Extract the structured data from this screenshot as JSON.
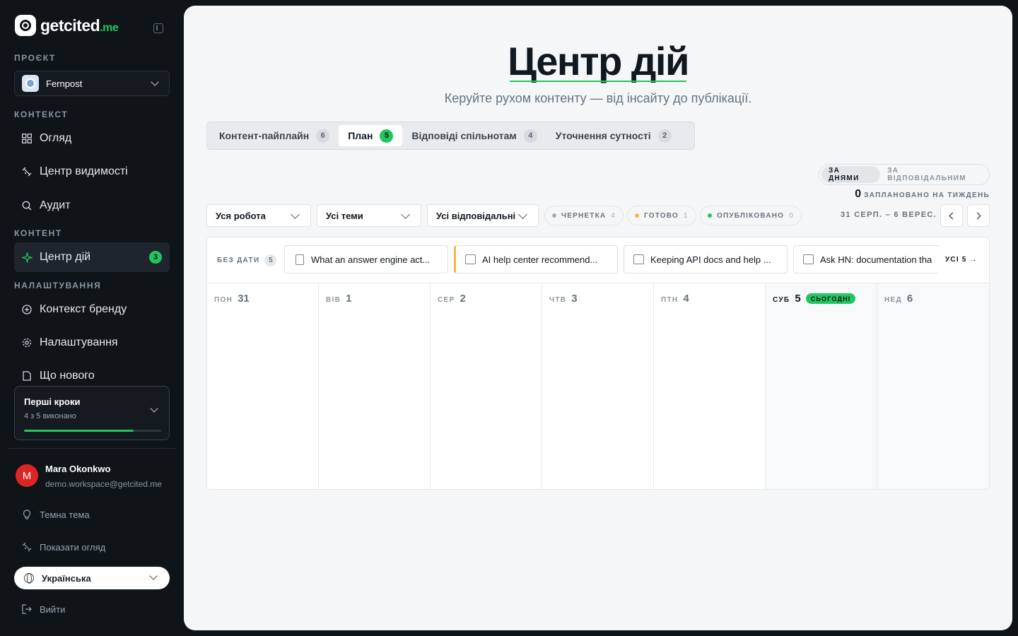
{
  "brand": {
    "name": "getcited",
    "tld": ".me",
    "accent": "#22c55e"
  },
  "sidebar": {
    "project_label": "ПРОЄКТ",
    "project_name": "Fernpost",
    "context_label": "КОНТЕКСТ",
    "context_items": [
      {
        "label": "Огляд",
        "icon": "grid-icon"
      },
      {
        "label": "Центр видимості",
        "icon": "satellite-icon"
      },
      {
        "label": "Аудит",
        "icon": "search-icon"
      }
    ],
    "content_label": "КОНТЕНТ",
    "content_items": [
      {
        "label": "Центр дій",
        "icon": "sparkle-icon",
        "badge": "3"
      }
    ],
    "settings_label": "НАЛАШТУВАННЯ",
    "settings_items": [
      {
        "label": "Контекст бренду",
        "icon": "plus-circle-icon"
      },
      {
        "label": "Налаштування",
        "icon": "gear-icon"
      },
      {
        "label": "Що нового",
        "icon": "doc-icon"
      }
    ],
    "steps": {
      "title": "Перші кроки",
      "subtitle": "4 з 5 виконано",
      "progress": 0.8
    },
    "user": {
      "initial": "M",
      "name": "Mara Okonkwo",
      "email": "demo.workspace@getcited.me"
    },
    "theme_label": "Темна тема",
    "tour_label": "Показати огляд",
    "language": "Українська",
    "logout_label": "Вийти"
  },
  "main": {
    "title": "Центр дій",
    "subtitle": "Керуйте рухом контенту — від інсайту до публікації.",
    "tabs": [
      {
        "label": "Контент-пайплайн",
        "count": "6"
      },
      {
        "label": "План",
        "count": "5"
      },
      {
        "label": "Відповіді спільнотам",
        "count": "4"
      },
      {
        "label": "Уточнення сутності",
        "count": "2"
      }
    ],
    "view_toggle": {
      "by_day": "ЗА ДНЯМИ",
      "by_owner": "ЗА ВІДПОВІДАЛЬНИМ"
    },
    "planned": {
      "count": "0",
      "label": "ЗАПЛАНОВАНО НА ТИЖДЕНЬ"
    },
    "filters": {
      "work": "Уся робота",
      "topics": "Усі теми",
      "owners": "Усі відповідальні"
    },
    "status_chips": [
      {
        "label": "ЧЕРНЕТКА",
        "count": "4",
        "color": "#a3adb6"
      },
      {
        "label": "ГОТОВО",
        "count": "1",
        "color": "#f5b642"
      },
      {
        "label": "ОПУБЛІКОВАНО",
        "count": "0",
        "color": "#22c55e"
      }
    ],
    "week_range": "31 СЕРП. – 6 ВЕРЕС.",
    "undated": {
      "label": "БЕЗ ДАТИ",
      "count": "5",
      "all_label": "УСІ 5 →",
      "cards": [
        {
          "text": "What an answer engine act...",
          "icon": "doc-icon"
        },
        {
          "text": "AI help center recommend...",
          "icon": "comment-icon"
        },
        {
          "text": "Keeping API docs and help ...",
          "icon": "comment-icon"
        },
        {
          "text": "Ask HN: documentation tha",
          "icon": "comment-icon"
        }
      ]
    },
    "days": [
      {
        "name": "ПОН",
        "num": "31"
      },
      {
        "name": "ВІВ",
        "num": "1"
      },
      {
        "name": "СЕР",
        "num": "2"
      },
      {
        "name": "ЧТВ",
        "num": "3"
      },
      {
        "name": "ПТН",
        "num": "4"
      },
      {
        "name": "СУБ",
        "num": "5",
        "badge": "СЬОГОДНІ"
      },
      {
        "name": "НЕД",
        "num": "6"
      }
    ]
  }
}
